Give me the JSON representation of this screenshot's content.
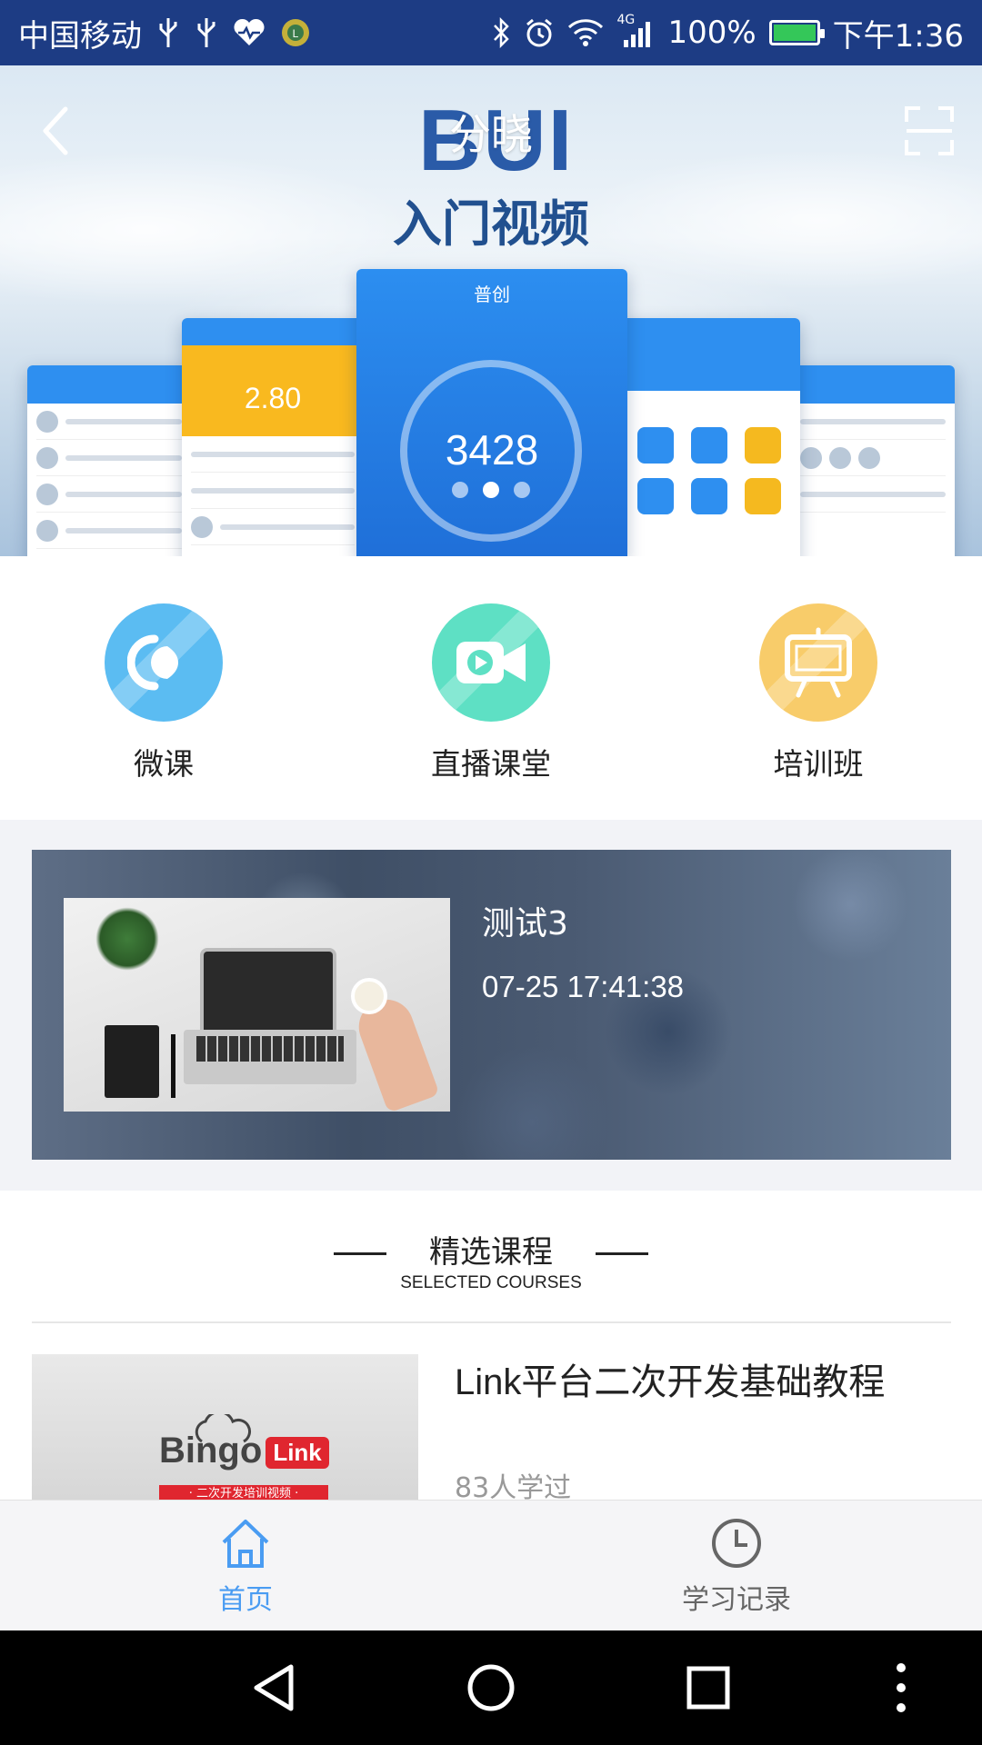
{
  "status_bar": {
    "carrier": "中国移动",
    "network": "4G",
    "battery": "100%",
    "time": "下午1:36",
    "icons": [
      "usb-icon",
      "usb-icon",
      "heart-rate-icon",
      "app-badge-icon",
      "bluetooth-icon",
      "alarm-icon",
      "wifi-icon",
      "signal-icon",
      "battery-charging-icon"
    ]
  },
  "header": {
    "title": "分晓",
    "back_icon": "chevron-left-icon",
    "scan_icon": "scan-icon"
  },
  "banner": {
    "logo": "BUI",
    "subtitle": "入门视频",
    "phone_title": "普创",
    "phone_number": "3428",
    "score": "2.80",
    "dots_total": 3,
    "dots_active_index": 1
  },
  "categories": [
    {
      "label": "微课",
      "icon": "micro-lesson-icon",
      "color": "#5bbcf2"
    },
    {
      "label": "直播课堂",
      "icon": "video-camera-icon",
      "color": "#5ee0c4"
    },
    {
      "label": "培训班",
      "icon": "easel-board-icon",
      "color": "#f8cc6a"
    }
  ],
  "live_card": {
    "title": "测试3",
    "time": "07-25 17:41:38"
  },
  "selected_courses": {
    "title": "精选课程",
    "subtitle": "SELECTED COURSES",
    "items": [
      {
        "title": "Link平台二次开发基础教程",
        "learners": "83人学过",
        "brand": "Bingo",
        "brand_link": "Link",
        "tag": "· 二次开发培训视频 ·"
      }
    ]
  },
  "tabbar": {
    "items": [
      {
        "label": "首页",
        "icon": "home-icon",
        "active": true
      },
      {
        "label": "学习记录",
        "icon": "clock-icon",
        "active": false
      }
    ],
    "active_color": "#4a9cf2"
  },
  "nav_bar": {
    "icons": [
      "back-triangle-icon",
      "home-circle-icon",
      "recents-square-icon",
      "more-dots-icon"
    ]
  }
}
